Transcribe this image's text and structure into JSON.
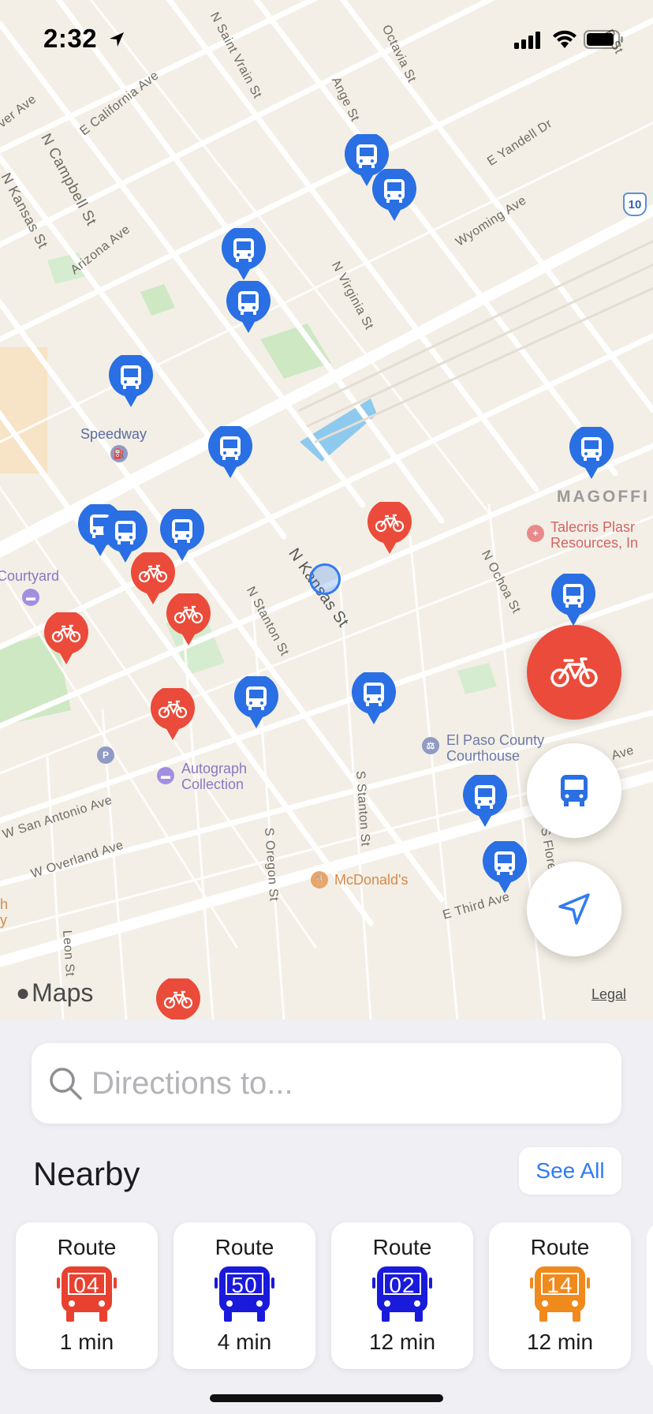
{
  "status_bar": {
    "time": "2:32"
  },
  "map": {
    "streets": [
      "N Saint Vrain St",
      "Arizona Ave",
      "Octavia St",
      "Ange St",
      "E California Ave",
      "N Campbell St",
      "N Kansas St",
      "Arizona Ave",
      "E Yandell Dr",
      "Wyoming Ave",
      "N Virginia St",
      "N Kansas St",
      "N Stanton St",
      "N Ochoa St",
      "S Stanton St",
      "S Oregon St",
      "W San Antonio Ave",
      "W Overland Ave",
      "Leon St",
      "E Third Ave",
      "S Flore",
      "Ave",
      "B St",
      "ver Ave"
    ],
    "pois": {
      "speedway": "Speedway",
      "courtyard": "Courtyard",
      "magoffin": "MAGOFFI",
      "talecris": "Talecris Plasr\nResources, In",
      "courthouse": "El Paso County\nCourthouse",
      "autograph": "Autograph\nCollection",
      "mcdonalds": "McDonald's",
      "parking": "P",
      "highway": "10",
      "partial_left": "h\ny"
    },
    "maps_logo": "Maps",
    "legal": "Legal"
  },
  "colors": {
    "bus": "#2a6fe3",
    "bike": "#eb4b3a",
    "accent": "#2f7bf5"
  },
  "search": {
    "placeholder": "Directions to..."
  },
  "nearby": {
    "title": "Nearby",
    "see_all": "See All",
    "routes": [
      {
        "label": "Route",
        "number": "04",
        "time": "1 min",
        "color": "#e8412f"
      },
      {
        "label": "Route",
        "number": "50",
        "time": "4 min",
        "color": "#1a1adc"
      },
      {
        "label": "Route",
        "number": "02",
        "time": "12 min",
        "color": "#1a1adc"
      },
      {
        "label": "Route",
        "number": "14",
        "time": "12 min",
        "color": "#f08a1c"
      }
    ]
  }
}
